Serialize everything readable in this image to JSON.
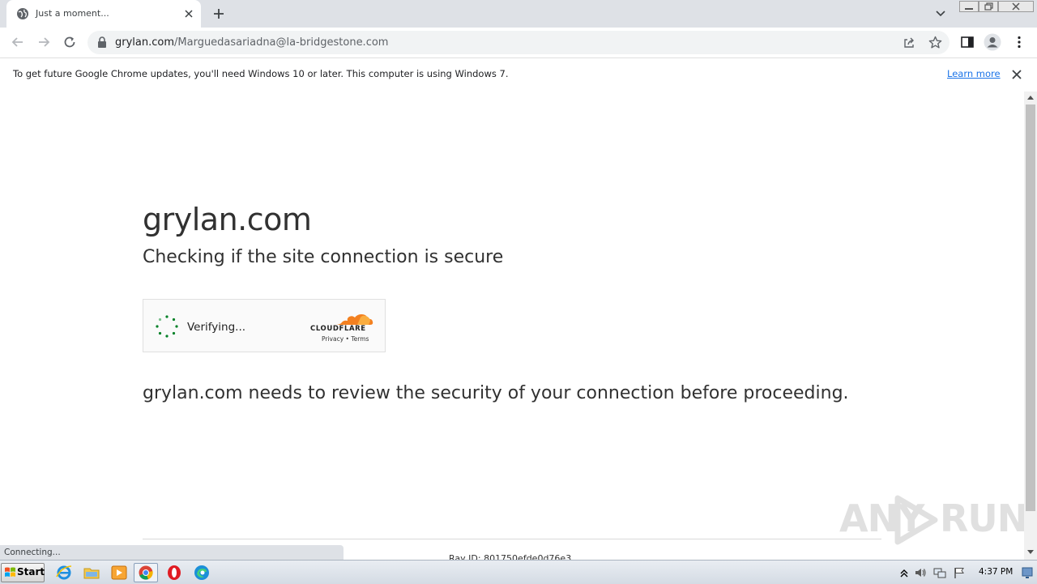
{
  "browser": {
    "tab": {
      "title": "Just a moment...",
      "favicon": "globe-icon"
    },
    "new_tab_icon": "plus-icon",
    "toolbar": {
      "url_host": "grylan.com",
      "url_path": "/Marguedasariadna@la-bridgestone.com"
    },
    "infobar": {
      "message": "To get future Google Chrome updates, you'll need Windows 10 or later. This computer is using Windows 7.",
      "link": "Learn more"
    },
    "status_text": "Connecting..."
  },
  "page": {
    "title": "grylan.com",
    "subtitle": "Checking if the site connection is secure",
    "widget": {
      "status": "Verifying...",
      "brand": "CLOUDFLARE",
      "links": "Privacy  •  Terms"
    },
    "review_text": "grylan.com needs to review the security of your connection before proceeding.",
    "ray_id": "Ray ID: 801750efde0d76e3"
  },
  "watermark": {
    "left": "ANY",
    "right": "RUN"
  },
  "taskbar": {
    "start_label": "Start",
    "apps": [
      "ie-icon",
      "folder-icon",
      "media-player-icon",
      "chrome-icon",
      "opera-icon",
      "edge-icon"
    ],
    "clock": "4:37 PM"
  },
  "colors": {
    "tabstrip": "#dee1e6",
    "link": "#1a73e8",
    "cloudflare_orange": "#f38020",
    "spinner_green": "#038127"
  }
}
